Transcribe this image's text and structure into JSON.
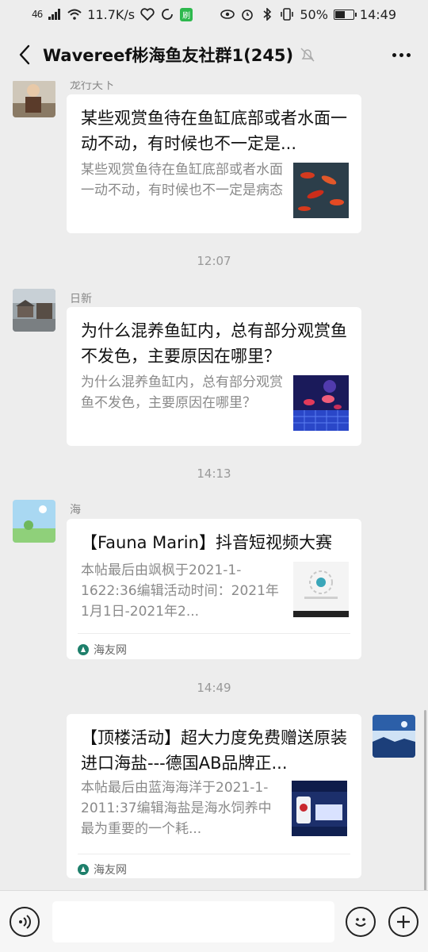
{
  "status_bar": {
    "network_type": "46",
    "speed": "11.7K/s",
    "badge": "刷",
    "battery": "50%",
    "time": "14:49"
  },
  "header": {
    "title": "Wavereef彬海鱼友社群1(245)",
    "icons": [
      "back-icon",
      "mute-bell-icon",
      "more-icon"
    ]
  },
  "messages": [
    {
      "sender": "龙行天下",
      "title": "某些观赏鱼待在鱼缸底部或者水面一动不动，有时候也不一定是...",
      "desc": "某些观赏鱼待在鱼缸底部或者水面一动不动，有时候也不一定是病态",
      "thumb": "red-fish-thumbnail"
    },
    {
      "timestamp": "12:07"
    },
    {
      "sender": "日新",
      "title": "为什么混养鱼缸内，总有部分观赏鱼不发色，主要原因在哪里？",
      "desc": "为什么混养鱼缸内，总有部分观赏鱼不发色，主要原因在哪里？",
      "thumb": "aquarium-thumbnail"
    },
    {
      "timestamp": "14:13"
    },
    {
      "sender": "海",
      "title": "【Fauna Marin】抖音短视频大赛",
      "desc": "本帖最后由飒枫于2021-1-1622:36编辑活动时间：2021年1月1日-2021年2...",
      "thumb": "fauna-marin-thumbnail",
      "source": "海友网"
    },
    {
      "timestamp": "14:49"
    },
    {
      "sender": "",
      "title": "【顶楼活动】超大力度免费赠送原装进口海盐---德国AB品牌正...",
      "desc": "本帖最后由蓝海海洋于2021-1-2011:37编辑海盐是海水饲养中最为重要的一个耗...",
      "thumb": "sea-salt-thumbnail",
      "source": "海友网"
    }
  ],
  "input_bar": {
    "icons": [
      "voice-icon",
      "emoji-icon",
      "plus-icon"
    ]
  }
}
